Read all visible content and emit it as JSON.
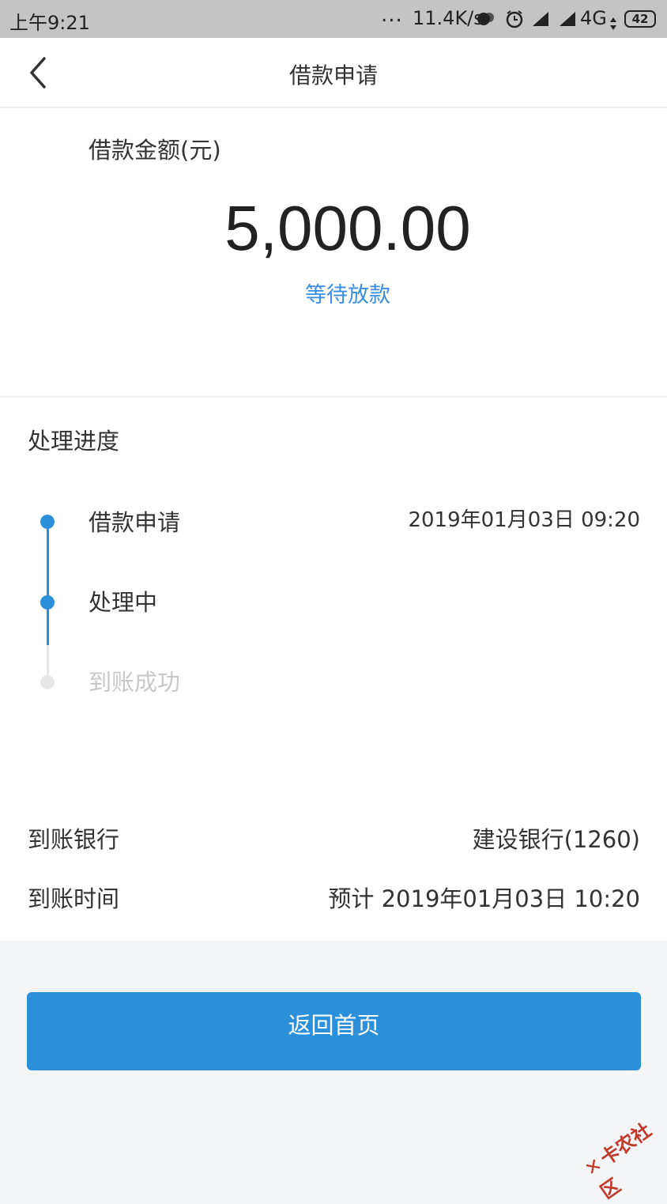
{
  "status_bar": {
    "time": "上午9:21",
    "dots": "...",
    "speed": "11.4K/s",
    "network": "4G",
    "battery": "42"
  },
  "nav": {
    "back_icon": "chevron-left-icon",
    "title": "借款申请"
  },
  "amount": {
    "label": "借款金额(元)",
    "value": "5,000.00",
    "status": "等待放款"
  },
  "progress": {
    "title": "处理进度",
    "steps": [
      {
        "label": "借款申请",
        "time": "2019年01月03日 09:20",
        "state": "done"
      },
      {
        "label": "处理中",
        "time": "",
        "state": "current"
      },
      {
        "label": "到账成功",
        "time": "",
        "state": "pending"
      }
    ]
  },
  "details": {
    "bank_label": "到账银行",
    "bank_value": "建设银行(1260)",
    "time_label": "到账时间",
    "time_value": "预计 2019年01月03日 10:20"
  },
  "actions": {
    "home_button": "返回首页"
  },
  "watermark": {
    "text": "卡农社区"
  },
  "colors": {
    "accent": "#2c8fd9",
    "status_text": "#3a8ee0",
    "pending": "#e6e6e6"
  }
}
